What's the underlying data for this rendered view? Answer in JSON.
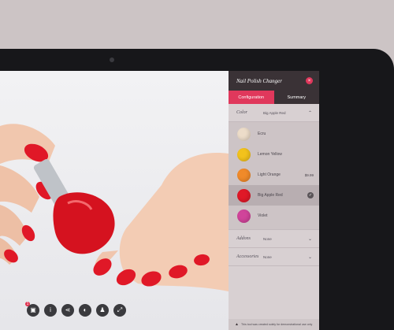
{
  "panel": {
    "title": "Nail Polish Changer",
    "close_icon": "×",
    "tabs": [
      {
        "label": "Configuration",
        "active": true
      },
      {
        "label": "Summary",
        "active": false
      }
    ]
  },
  "color_section": {
    "title": "Color",
    "value": "Big Apple Red",
    "chevron": "⌃",
    "items": [
      {
        "name": "Ecru",
        "color": "#ecdcc9",
        "price": "",
        "selected": false
      },
      {
        "name": "Lemon Yellow",
        "color": "#f2c21c",
        "price": "",
        "selected": false
      },
      {
        "name": "Light Orange",
        "color": "#f08a2a",
        "price": "$9.99",
        "selected": false
      },
      {
        "name": "Big Apple Red",
        "color": "#e01827",
        "price": "",
        "selected": true
      },
      {
        "name": "Violet",
        "color": "#d0449a",
        "price": "",
        "selected": false
      }
    ]
  },
  "addons_section": {
    "title": "Addons",
    "value": "None",
    "chevron": "⌄"
  },
  "accessories_section": {
    "title": "Accessories",
    "value": "None",
    "chevron": "⌄"
  },
  "disclaimer": {
    "icon": "warning-icon",
    "text": "This tool was created solely for demonstrational use only"
  },
  "toolbar": {
    "buttons": [
      "camera-icon",
      "info-icon",
      "share-icon",
      "view-icon",
      "person-icon",
      "fullscreen-icon"
    ],
    "badge": "1"
  },
  "colors": {
    "accent": "#e0385c",
    "header": "#3a3236",
    "nail": "#e01827"
  }
}
